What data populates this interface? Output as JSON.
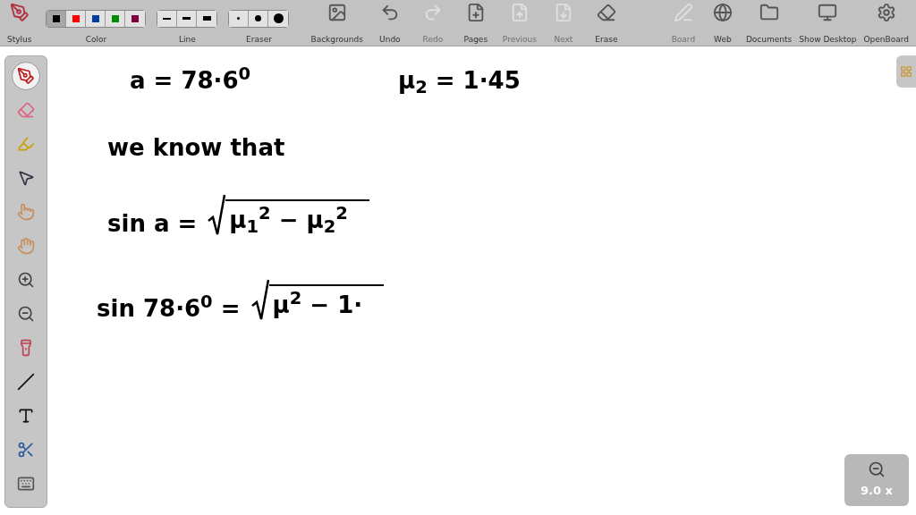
{
  "toolbar": {
    "stylus": {
      "label": "Stylus"
    },
    "color": {
      "label": "Color",
      "swatches": [
        {
          "color": "#000000",
          "selected": true
        },
        {
          "color": "#ff0000",
          "selected": false
        },
        {
          "color": "#003f9e",
          "selected": false
        },
        {
          "color": "#008c00",
          "selected": false
        },
        {
          "color": "#7f0040",
          "selected": false
        }
      ]
    },
    "line": {
      "label": "Line",
      "widths": [
        {
          "selected": false
        },
        {
          "selected": false
        },
        {
          "selected": false
        }
      ]
    },
    "eraser": {
      "label": "Eraser",
      "sizes": [
        {
          "selected": false
        },
        {
          "selected": false
        },
        {
          "selected": false
        }
      ]
    },
    "buttons": [
      {
        "label": "Backgrounds",
        "disabled": false
      },
      {
        "label": "Undo",
        "disabled": false
      },
      {
        "label": "Redo",
        "disabled": true
      },
      {
        "label": "Pages",
        "disabled": false
      },
      {
        "label": "Previous",
        "disabled": true
      },
      {
        "label": "Next",
        "disabled": true
      },
      {
        "label": "Erase",
        "disabled": false
      }
    ],
    "right_buttons": [
      {
        "label": "Board",
        "disabled": true
      },
      {
        "label": "Web",
        "disabled": false
      },
      {
        "label": "Documents",
        "disabled": false
      },
      {
        "label": "Show Desktop",
        "disabled": false
      },
      {
        "label": "OpenBoard",
        "disabled": false
      }
    ]
  },
  "tools": [
    {
      "selected": true
    },
    {
      "selected": false
    },
    {
      "selected": false
    },
    {
      "selected": false
    },
    {
      "selected": false
    },
    {
      "selected": false
    },
    {
      "selected": false
    },
    {
      "selected": false
    },
    {
      "selected": false
    },
    {
      "selected": false
    },
    {
      "selected": false
    },
    {
      "selected": false
    },
    {
      "selected": false
    }
  ],
  "ink": [
    {
      "kind": "text",
      "text": "a = 78·6$^{0}$"
    },
    {
      "kind": "text",
      "text": "μ$_{2}$ = 1·45"
    },
    {
      "kind": "text",
      "text": "we know that"
    },
    {
      "kind": "root",
      "lhs": "sin a =",
      "radicand": "μ$_{1}$$^{2}$ − μ$_{2}$$^{2}$"
    },
    {
      "kind": "root",
      "lhs": "sin 78·6$^{0}$ =",
      "radicand": "μ$^{2}$ − 1·"
    }
  ],
  "zoom": {
    "label": "9.0 x"
  }
}
